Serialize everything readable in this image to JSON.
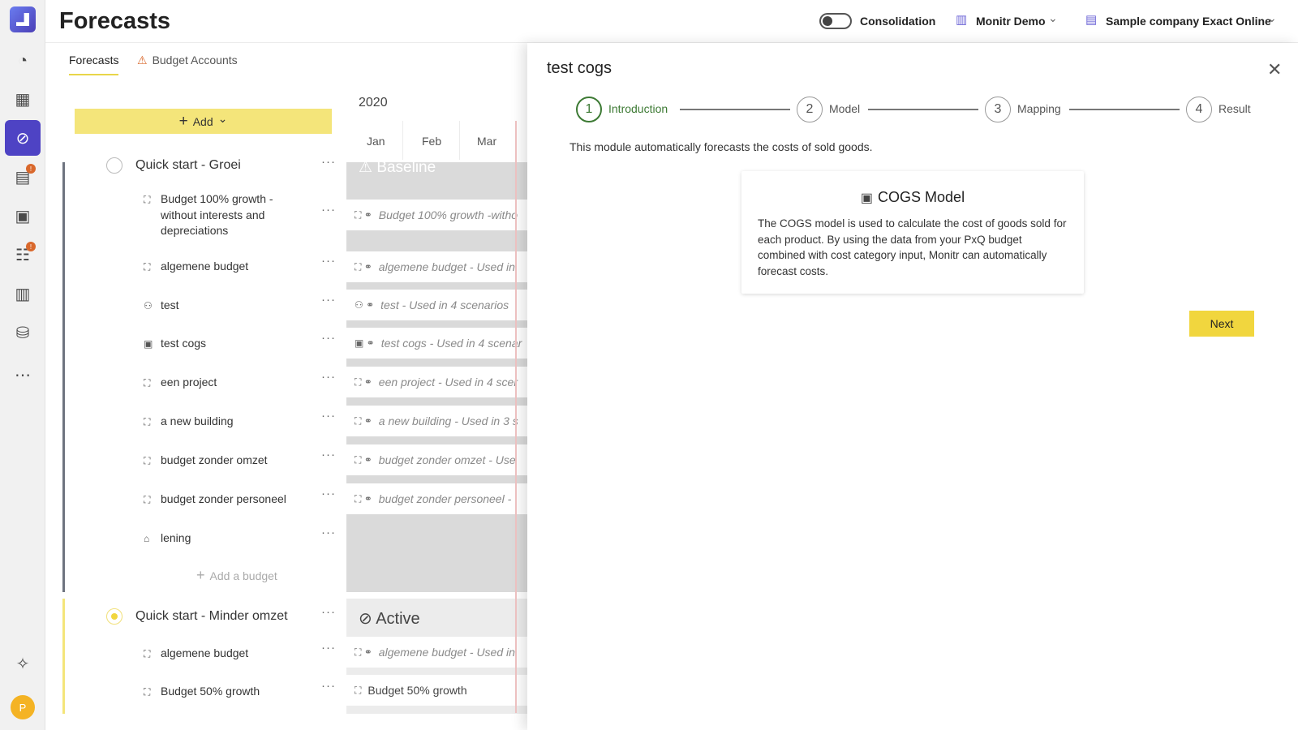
{
  "header": {
    "title": "Forecasts",
    "consolidation_label": "Consolidation",
    "workspace": "Monitr Demo",
    "company": "Sample company Exact Online",
    "chevron": "⌄"
  },
  "rail": {
    "avatar_initial": "P"
  },
  "tabs": [
    {
      "label": "Forecasts"
    },
    {
      "label": "Budget Accounts"
    }
  ],
  "toolbar": {
    "add_label": "Add"
  },
  "timeline": {
    "year": "2020",
    "months": [
      "Jan",
      "Feb",
      "Mar"
    ],
    "baseline_label": "Baseline",
    "active_label": "Active"
  },
  "scenarios": [
    {
      "name": "Quick start - Groei",
      "budgets": [
        {
          "label": "Budget 100% growth - without interests and depreciations",
          "timeline": "Budget 100% growth -witho"
        },
        {
          "label": "algemene budget",
          "timeline": "algemene budget - Used in"
        },
        {
          "label": "test",
          "timeline": "test - Used in 4 scenarios"
        },
        {
          "label": "test cogs",
          "timeline": "test cogs - Used in 4 scenar"
        },
        {
          "label": "een project",
          "timeline": "een project - Used in 4 scer"
        },
        {
          "label": "a new building",
          "timeline": "a new building - Used in 3 s"
        },
        {
          "label": "budget zonder omzet",
          "timeline": "budget zonder omzet - Use"
        },
        {
          "label": "budget zonder personeel",
          "timeline": "budget zonder personeel -"
        },
        {
          "label": "lening",
          "timeline": ""
        }
      ],
      "add_budget_label": "Add a budget"
    },
    {
      "name": "Quick start - Minder omzet",
      "budgets": [
        {
          "label": "algemene budget",
          "timeline": "algemene budget - Used in"
        },
        {
          "label": "Budget 50% growth",
          "timeline": "Budget 50% growth"
        }
      ]
    }
  ],
  "panel": {
    "title": "test cogs",
    "steps": [
      {
        "num": "1",
        "label": "Introduction"
      },
      {
        "num": "2",
        "label": "Model"
      },
      {
        "num": "3",
        "label": "Mapping"
      },
      {
        "num": "4",
        "label": "Result"
      }
    ],
    "description": "This module automatically forecasts the costs of sold goods.",
    "card_title": "COGS Model",
    "card_text": "The COGS model is used to calculate the cost of goods sold for each product. By using the data from your PxQ budget combined with cost category input, Monitr can automatically forecast costs.",
    "next_label": "Next"
  },
  "icons": {
    "close": "✕",
    "dots": "···",
    "plus": "+",
    "chevron_down": "⌄"
  }
}
